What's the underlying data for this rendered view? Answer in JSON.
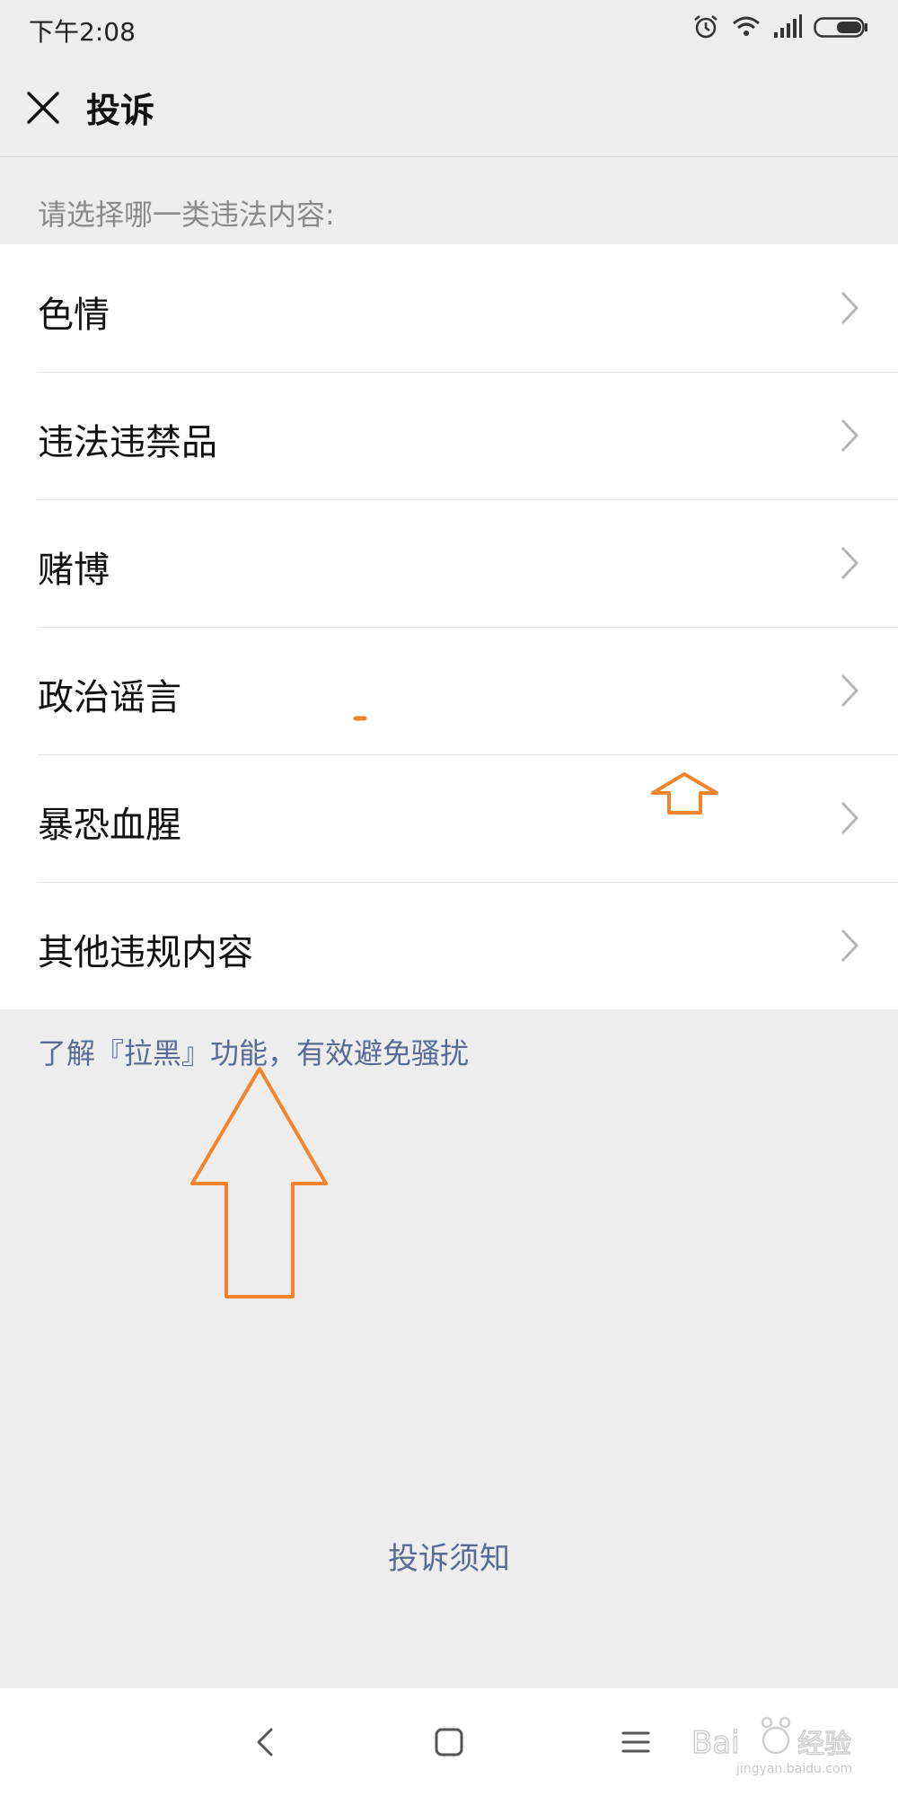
{
  "status_bar": {
    "time": "下午2:08",
    "icons": [
      "alarm-icon",
      "wifi-icon",
      "signal-icon",
      "battery-icon"
    ]
  },
  "header": {
    "title": "投诉",
    "close_icon": "close-icon"
  },
  "section_label": "请选择哪一类违法内容:",
  "items": [
    {
      "label": "色情"
    },
    {
      "label": "违法违禁品"
    },
    {
      "label": "赌博"
    },
    {
      "label": "政治谣言"
    },
    {
      "label": "暴恐血腥"
    },
    {
      "label": "其他违规内容"
    }
  ],
  "blacklist_link": "了解『拉黑』功能，有效避免骚扰",
  "notice_link": "投诉须知",
  "nav": {
    "buttons": [
      "back-icon",
      "home-icon",
      "menu-icon"
    ]
  },
  "watermark": {
    "text": "jingyan.baidu.com"
  },
  "colors": {
    "background": "#ededed",
    "link": "#576b95",
    "annotation": "#f5832b"
  }
}
